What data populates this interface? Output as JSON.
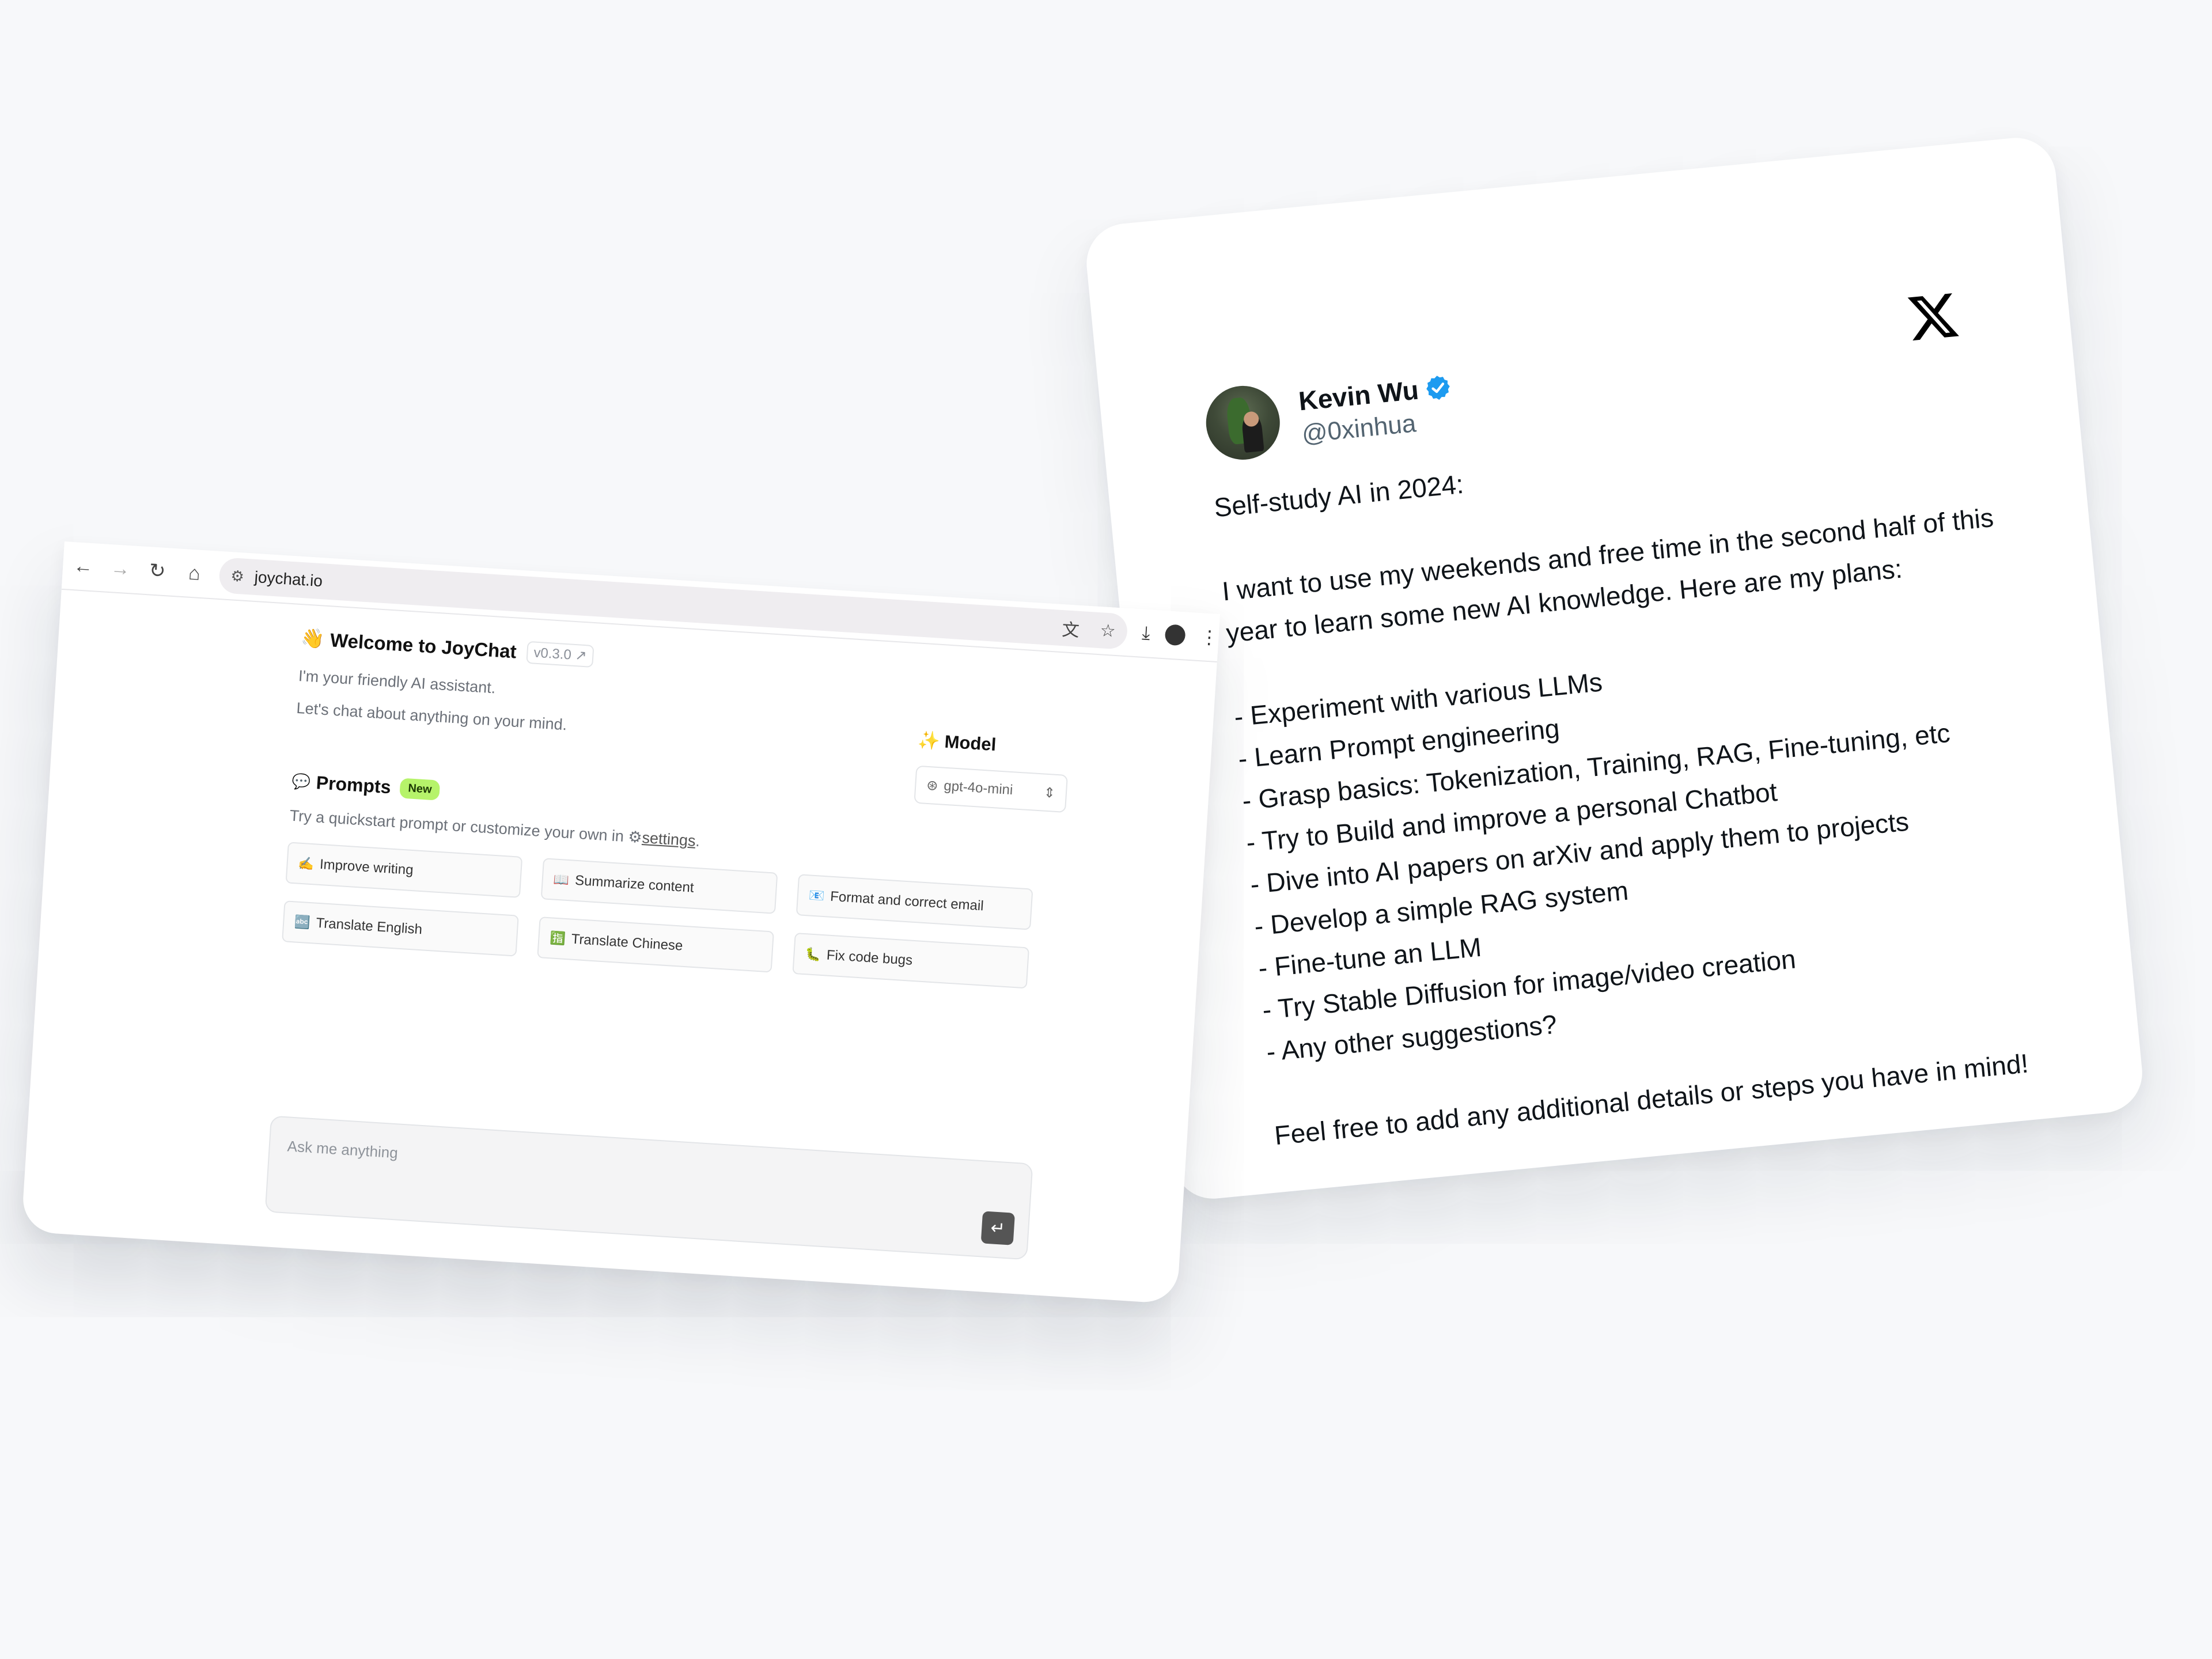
{
  "tweet": {
    "display_name": "Kevin Wu",
    "handle": "@0xinhua",
    "verified_icon": "verified-badge-icon",
    "logo_icon": "x-logo-icon",
    "intro": "Self-study AI in 2024:",
    "paragraph": "I want to use my weekends and free time in the second half of this year to learn some new AI knowledge. Here are my plans:",
    "plans": [
      "- Experiment with various LLMs",
      "- Learn Prompt engineering",
      "- Grasp basics: Tokenization, Training, RAG, Fine-tuning, etc",
      "- Try to Build and improve a personal Chatbot",
      "- Dive into AI papers on arXiv and apply them to projects",
      "- Develop a simple RAG system",
      "- Fine-tune an LLM",
      "- Try Stable Diffusion for image/video creation",
      "- Any other suggestions?"
    ],
    "closing": "Feel free to add any additional details or steps you have in mind!"
  },
  "browser": {
    "url": "joychat.io",
    "icons": {
      "back": "back-arrow-icon",
      "forward": "forward-arrow-icon",
      "reload": "reload-icon",
      "home": "home-icon",
      "site_settings": "site-settings-icon",
      "translate": "translate-icon",
      "bookmark": "star-icon",
      "download": "download-icon",
      "profile": "profile-avatar",
      "menu": "kebab-menu-icon"
    }
  },
  "joychat": {
    "welcome_emoji": "👋",
    "welcome_title": "Welcome to JoyChat",
    "version": "v0.3.0 ↗",
    "subtitle_line1": "I'm your friendly AI assistant.",
    "subtitle_line2": "Let's chat about anything on your mind.",
    "model_label": "Model",
    "model_value": "gpt-4o-mini",
    "prompts_title": "Prompts",
    "new_badge": "New",
    "prompts_hint_before": "Try a quickstart prompt or customize your own in",
    "settings_link": "settings",
    "prompts_hint_after": ".",
    "prompt_cards": [
      {
        "emoji": "✍️",
        "label": "Improve writing"
      },
      {
        "emoji": "📖",
        "label": "Summarize content"
      },
      {
        "emoji": "📧",
        "label": "Format and correct email"
      },
      {
        "emoji": "🔤",
        "label": "Translate English"
      },
      {
        "emoji": "🈯",
        "label": "Translate Chinese"
      },
      {
        "emoji": "🐛",
        "label": "Fix code bugs"
      }
    ],
    "input_placeholder": "Ask me anything",
    "send_icon": "enter-key-icon",
    "accent_badge_color": "#b6f36a"
  }
}
